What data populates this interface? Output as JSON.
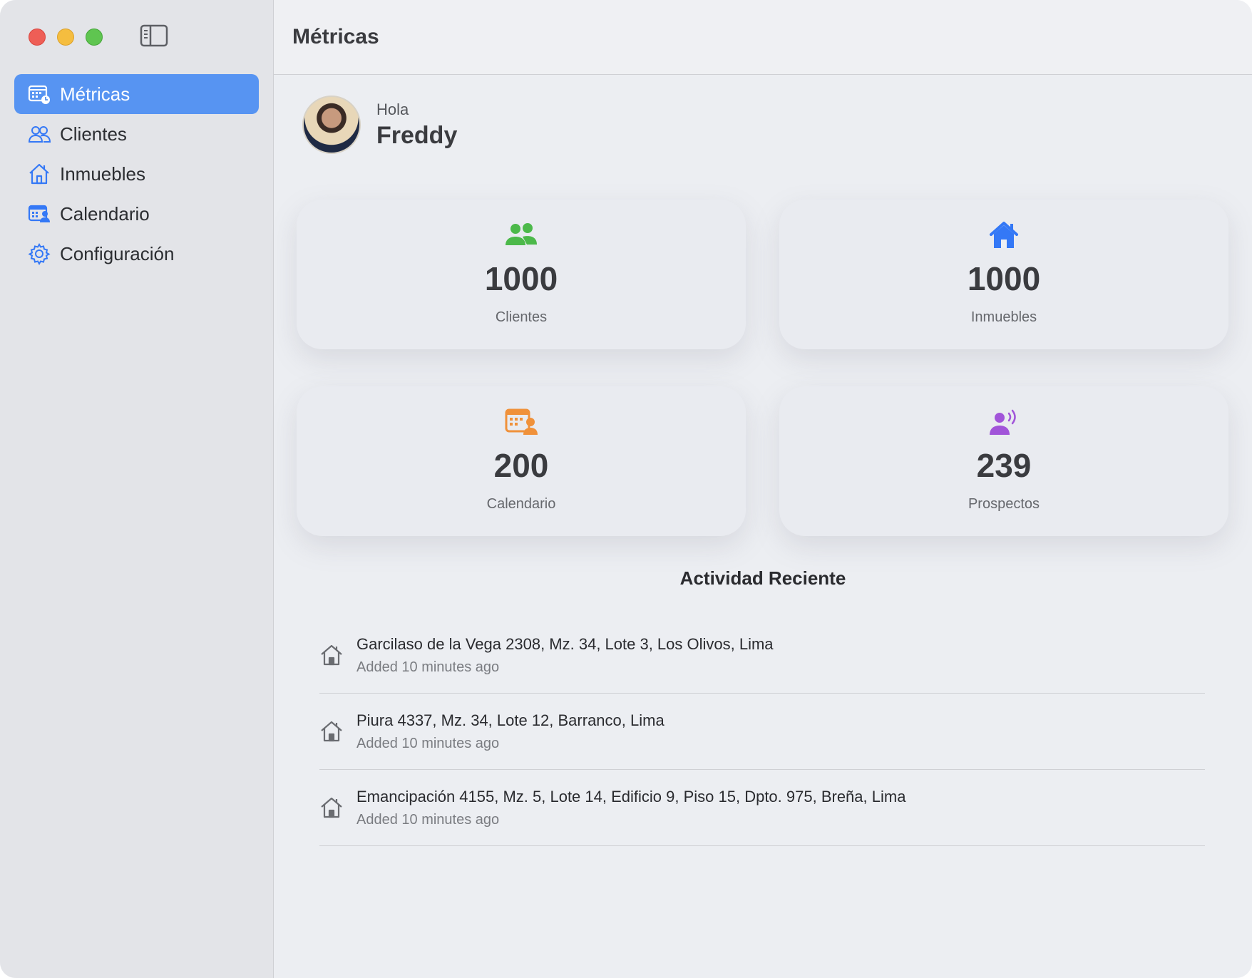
{
  "window": {
    "title": "Métricas"
  },
  "sidebar": {
    "items": [
      {
        "label": "Métricas",
        "icon": "calendar-clock-icon",
        "active": true
      },
      {
        "label": "Clientes",
        "icon": "people-icon",
        "active": false
      },
      {
        "label": "Inmuebles",
        "icon": "house-icon",
        "active": false
      },
      {
        "label": "Calendario",
        "icon": "calendar-person-icon",
        "active": false
      },
      {
        "label": "Configuración",
        "icon": "gear-icon",
        "active": false
      }
    ]
  },
  "greeting": {
    "hello": "Hola",
    "name": "Freddy"
  },
  "cards": [
    {
      "value": "1000",
      "label": "Clientes",
      "icon": "people-icon",
      "color": "#4cb94a"
    },
    {
      "value": "1000",
      "label": "Inmuebles",
      "icon": "house-icon",
      "color": "#3478f6"
    },
    {
      "value": "200",
      "label": "Calendario",
      "icon": "calendar-person-icon",
      "color": "#f0913a"
    },
    {
      "value": "239",
      "label": "Prospectos",
      "icon": "person-wave-icon",
      "color": "#a154d9"
    }
  ],
  "activity": {
    "title": "Actividad Reciente",
    "items": [
      {
        "title": "Garcilaso de la Vega 2308, Mz. 34, Lote 3, Los Olivos, Lima",
        "subtitle": "Added 10 minutes ago"
      },
      {
        "title": "Piura 4337, Mz. 34, Lote 12, Barranco, Lima",
        "subtitle": "Added 10 minutes ago"
      },
      {
        "title": "Emancipación 4155, Mz. 5, Lote 14, Edificio 9, Piso 15, Dpto. 975, Breña, Lima",
        "subtitle": "Added 10 minutes ago"
      }
    ]
  },
  "colors": {
    "accent": "#5794f2",
    "sidebar_icon": "#3478f6"
  }
}
